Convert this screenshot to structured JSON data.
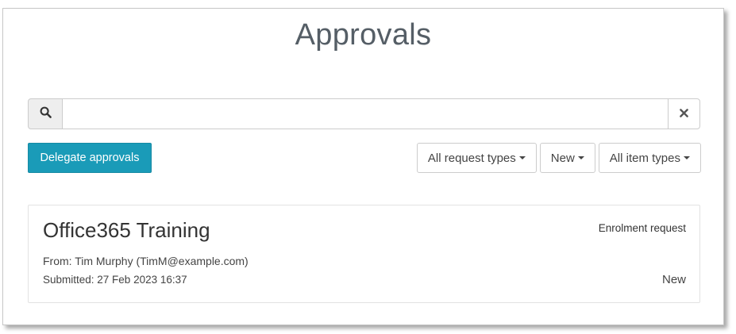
{
  "page": {
    "title": "Approvals"
  },
  "search": {
    "icon": "magnifier-icon",
    "value": "",
    "placeholder": "",
    "clear_icon": "close-icon"
  },
  "toolbar": {
    "delegate_label": "Delegate approvals",
    "filters": [
      {
        "label": "All request types"
      },
      {
        "label": "New"
      },
      {
        "label": "All item types"
      }
    ]
  },
  "approvals": [
    {
      "title": "Office365 Training",
      "request_type": "Enrolment request",
      "from": "From: Tim Murphy (TimM@example.com)",
      "submitted": "Submitted: 27 Feb 2023 16:37",
      "status": "New"
    }
  ],
  "colors": {
    "primary_button": "#1a9bb8",
    "title_text": "#555e66",
    "border": "#cccccc"
  }
}
